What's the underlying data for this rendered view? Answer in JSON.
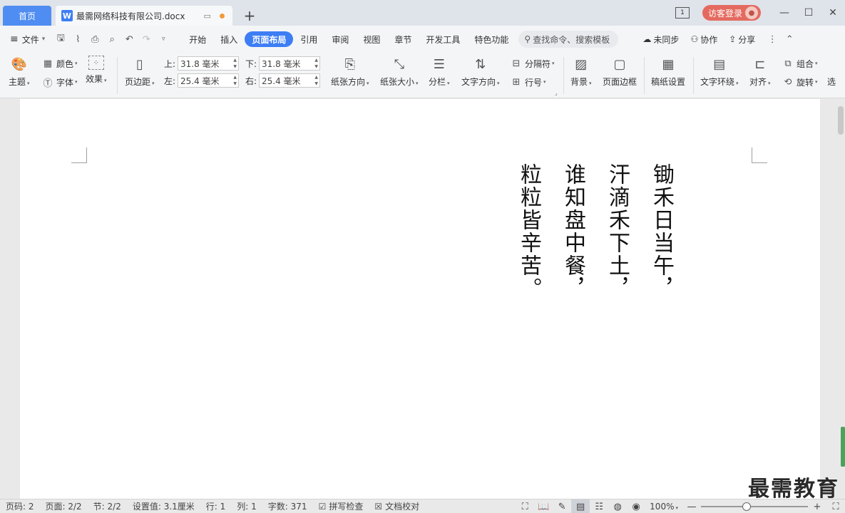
{
  "titlebar": {
    "home_tab": "首页",
    "doc_tab": "最需网络科技有限公司.docx",
    "new_tab": "+",
    "login": "访客登录",
    "win_mode": "1",
    "minimize": "—",
    "maximize": "☐",
    "close": "✕"
  },
  "menubar": {
    "file": "文件",
    "tabs": [
      "开始",
      "插入",
      "页面布局",
      "引用",
      "审阅",
      "视图",
      "章节",
      "开发工具",
      "特色功能"
    ],
    "active_tab": "页面布局",
    "search": "查找命令、搜索模板",
    "sync": "未同步",
    "collab": "协作",
    "share": "分享"
  },
  "ribbon": {
    "theme": "主题",
    "color": "颜色",
    "font": "字体",
    "effect": "效果",
    "margin": "页边距",
    "top_label": "上:",
    "top_value": "31.8 毫米",
    "bottom_label": "下:",
    "bottom_value": "31.8 毫米",
    "left_label": "左:",
    "left_value": "25.4 毫米",
    "right_label": "右:",
    "right_value": "25.4 毫米",
    "orientation": "纸张方向",
    "size": "纸张大小",
    "columns": "分栏",
    "text_direction": "文字方向",
    "breaks": "分隔符",
    "line_numbers": "行号",
    "background": "背景",
    "page_border": "页面边框",
    "manuscript": "稿纸设置",
    "wrap": "文字环绕",
    "align": "对齐",
    "group": "组合",
    "rotate": "旋转",
    "select": "选"
  },
  "document": {
    "poem_lines": [
      "锄禾日当午，",
      "汗滴禾下土，",
      "谁知盘中餐，",
      "粒粒皆辛苦。"
    ]
  },
  "watermark": "最需教育",
  "statusbar": {
    "page_no": "页码: 2",
    "pages": "页面: 2/2",
    "section": "节: 2/2",
    "setting": "设置值: 3.1厘米",
    "row": "行: 1",
    "col": "列: 1",
    "words": "字数: 371",
    "spell": "拼写检查",
    "proof": "文档校对",
    "zoom": "100%",
    "zoom_out": "—",
    "zoom_in": "+",
    "zoom_fraction": 0.42
  }
}
